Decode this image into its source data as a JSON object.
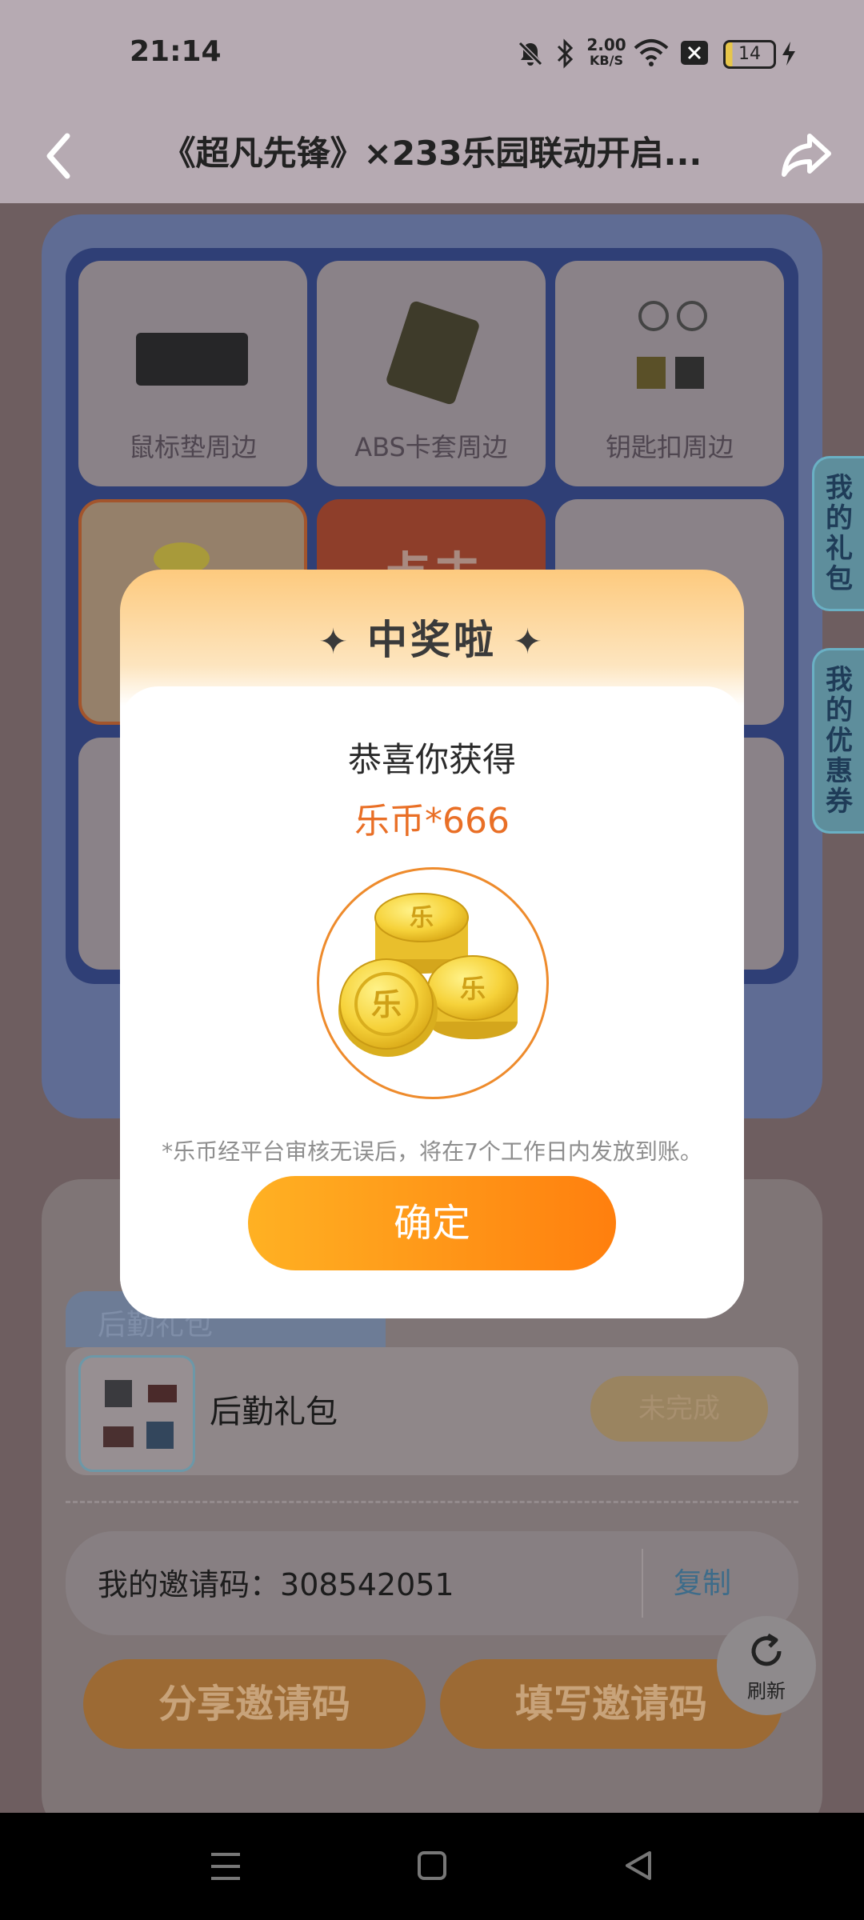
{
  "status_bar": {
    "time": "21:14",
    "network_speed_value": "2.00",
    "network_speed_unit": "KB/S",
    "battery": "14",
    "icons": [
      "mute-icon",
      "bluetooth-icon",
      "wifi-icon",
      "close-box-icon",
      "battery-icon",
      "charging-icon"
    ]
  },
  "header": {
    "title": "《超凡先锋》×233乐园联动开启...",
    "back_icon": "back-arrow-icon",
    "share_icon": "share-icon"
  },
  "prize_grid": {
    "tiles": [
      {
        "label": "鼠标垫周边"
      },
      {
        "label": "ABS卡套周边"
      },
      {
        "label": "钥匙扣周边"
      },
      {
        "label": ""
      },
      {
        "label": "点击"
      },
      {
        "label": ""
      }
    ]
  },
  "side_tabs": {
    "my_gifts": "我的礼包",
    "my_coupons": "我的优惠券"
  },
  "tasks": {
    "section_title": "后勤礼包",
    "gift_name": "后勤礼包",
    "gift_status": "未完成",
    "invite_label": "我的邀请码：",
    "invite_code": "308542051",
    "copy": "复制",
    "share_invite": "分享邀请码",
    "fill_invite": "填写邀请码",
    "refresh": "刷新"
  },
  "modal": {
    "title": "中奖啦",
    "congrats": "恭喜你获得",
    "prize": "乐币*666",
    "coin_glyph": "乐",
    "note": "*乐币经平台审核无误后，将在7个工作日内发放到账。",
    "confirm": "确定"
  },
  "colors": {
    "accent_orange": "#ff8a12",
    "prize_text": "#e96f26",
    "modal_header": "#fdca7e"
  }
}
